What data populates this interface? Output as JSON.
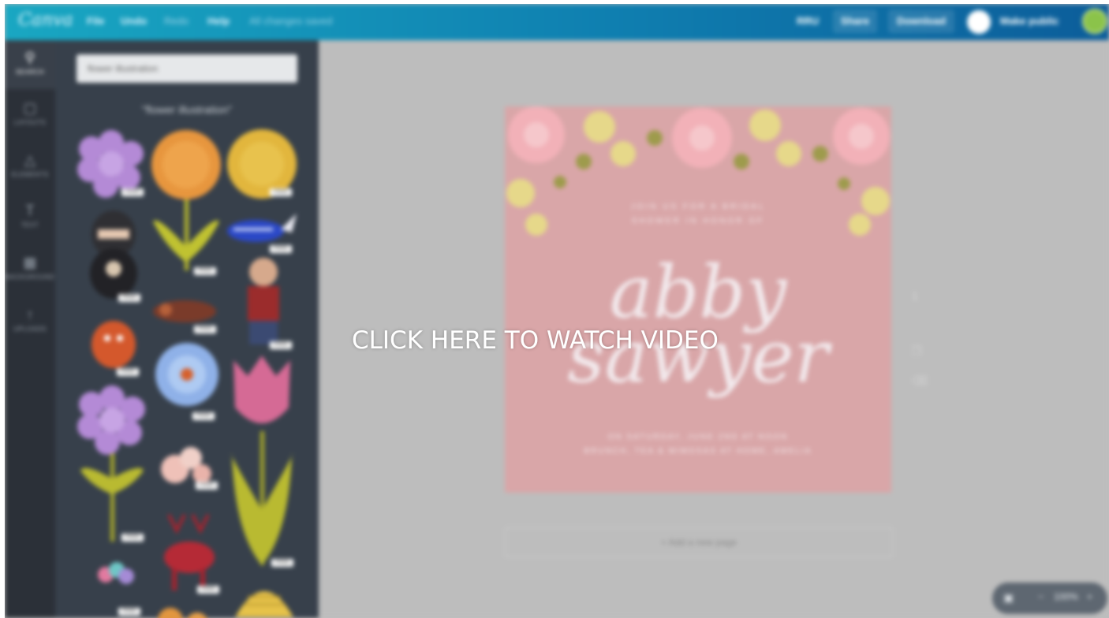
{
  "topbar": {
    "logo": "Canva",
    "menu": [
      "File",
      "Undo",
      "Redo",
      "Help"
    ],
    "saved_status": "All changes saved",
    "right_items": {
      "resize": "RRU",
      "share": "Share",
      "download": "Download",
      "make_public": "Make public"
    }
  },
  "rail": {
    "items": [
      {
        "label": "SEARCH",
        "icon": "search-icon",
        "active": true
      },
      {
        "label": "LAYOUTS",
        "icon": "layouts-icon",
        "active": false
      },
      {
        "label": "ELEMENTS",
        "icon": "elements-icon",
        "active": false
      },
      {
        "label": "TEXT",
        "icon": "text-icon",
        "active": false
      },
      {
        "label": "BACKGROUND",
        "icon": "background-icon",
        "active": false
      },
      {
        "label": "UPLOADS",
        "icon": "uploads-icon",
        "active": false
      }
    ]
  },
  "search": {
    "query": "flower illustration",
    "results_title": "\"flower illustration\"",
    "badge": "FREE"
  },
  "canvas": {
    "top_text_1": "JOIN US FOR A BRIDAL",
    "top_text_2": "SHOWER IN HONOR OF",
    "name_1": "abby",
    "name_2": "sawyer",
    "bottom_text_1": "ON SATURDAY, JUNE 2ND AT NOON",
    "bottom_text_2": "BRUNCH, TEA & MIMOSAS AT HOME, AMELIA",
    "add_page": "+ Add a new page",
    "page_number": "1"
  },
  "zoom": {
    "value": "100%",
    "minus": "−",
    "plus": "+"
  },
  "overlay": {
    "cta": "CLICK HERE TO WATCH VIDEO"
  },
  "colors": {
    "topbar_start": "#19a7c2",
    "topbar_end": "#0c5d9a",
    "panel": "#37404b",
    "rail": "#2b3038",
    "page": "#d9a6a8"
  }
}
